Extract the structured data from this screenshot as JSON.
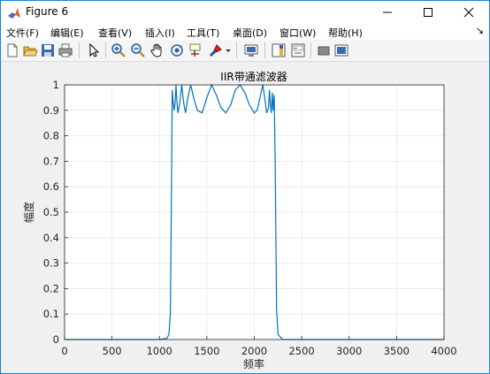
{
  "window": {
    "title": "Figure 6",
    "controls": {
      "minimize": "—",
      "maximize": "☐",
      "close": "✕"
    }
  },
  "menu": {
    "items": [
      "文件(F)",
      "编辑(E)",
      "查看(V)",
      "插入(I)",
      "工具(T)",
      "桌面(D)",
      "窗口(W)",
      "帮助(H)"
    ],
    "dock_arrow": "↘"
  },
  "toolbar": {
    "icons": [
      "new-figure-icon",
      "open-file-icon",
      "save-icon",
      "print-icon",
      "edit-plot-arrow-icon",
      "zoom-in-icon",
      "zoom-out-icon",
      "pan-hand-icon",
      "rotate-3d-icon",
      "data-cursor-icon",
      "brush-icon",
      "brush-dropdown-icon",
      "link-plot-icon",
      "insert-colorbar-icon",
      "insert-legend-icon",
      "hide-plot-tools-icon",
      "show-plot-tools-icon"
    ]
  },
  "chart_data": {
    "type": "line",
    "title": "IIR带通滤波器",
    "xlabel": "频率",
    "ylabel": "幅度",
    "xlim": [
      0,
      4000
    ],
    "ylim": [
      0,
      1
    ],
    "xticks": [
      "0",
      "500",
      "1000",
      "1500",
      "2000",
      "2500",
      "3000",
      "3500",
      "4000"
    ],
    "yticks": [
      "0",
      "0.1",
      "0.2",
      "0.3",
      "0.4",
      "0.5",
      "0.6",
      "0.7",
      "0.8",
      "0.9",
      "1"
    ],
    "grid": true,
    "line_color": "#0072bd",
    "series": [
      {
        "x": [
          0,
          1000,
          1080,
          1100,
          1115,
          1125,
          1135,
          1145,
          1155,
          1165,
          1175,
          1185,
          1195,
          1215,
          1235,
          1255,
          1275,
          1300,
          1330,
          1360,
          1400,
          1450,
          1500,
          1550,
          1600,
          1650,
          1700,
          1750,
          1800,
          1850,
          1900,
          1950,
          2000,
          2030,
          2060,
          2090,
          2110,
          2130,
          2150,
          2160,
          2170,
          2180,
          2190,
          2200,
          2210,
          2220,
          2235,
          2250,
          2300,
          4000
        ],
        "values": [
          0,
          0,
          0.005,
          0.02,
          0.1,
          0.5,
          0.98,
          0.93,
          0.9,
          0.93,
          1.0,
          0.93,
          0.89,
          0.93,
          1.0,
          0.93,
          0.89,
          0.95,
          1.0,
          0.95,
          0.9,
          0.89,
          0.95,
          1.0,
          0.96,
          0.91,
          0.89,
          0.92,
          0.98,
          1.0,
          0.97,
          0.92,
          0.89,
          0.9,
          0.95,
          1.0,
          0.95,
          0.89,
          0.91,
          0.98,
          0.92,
          0.89,
          0.97,
          0.9,
          0.96,
          0.7,
          0.12,
          0.02,
          0,
          0
        ]
      }
    ]
  }
}
